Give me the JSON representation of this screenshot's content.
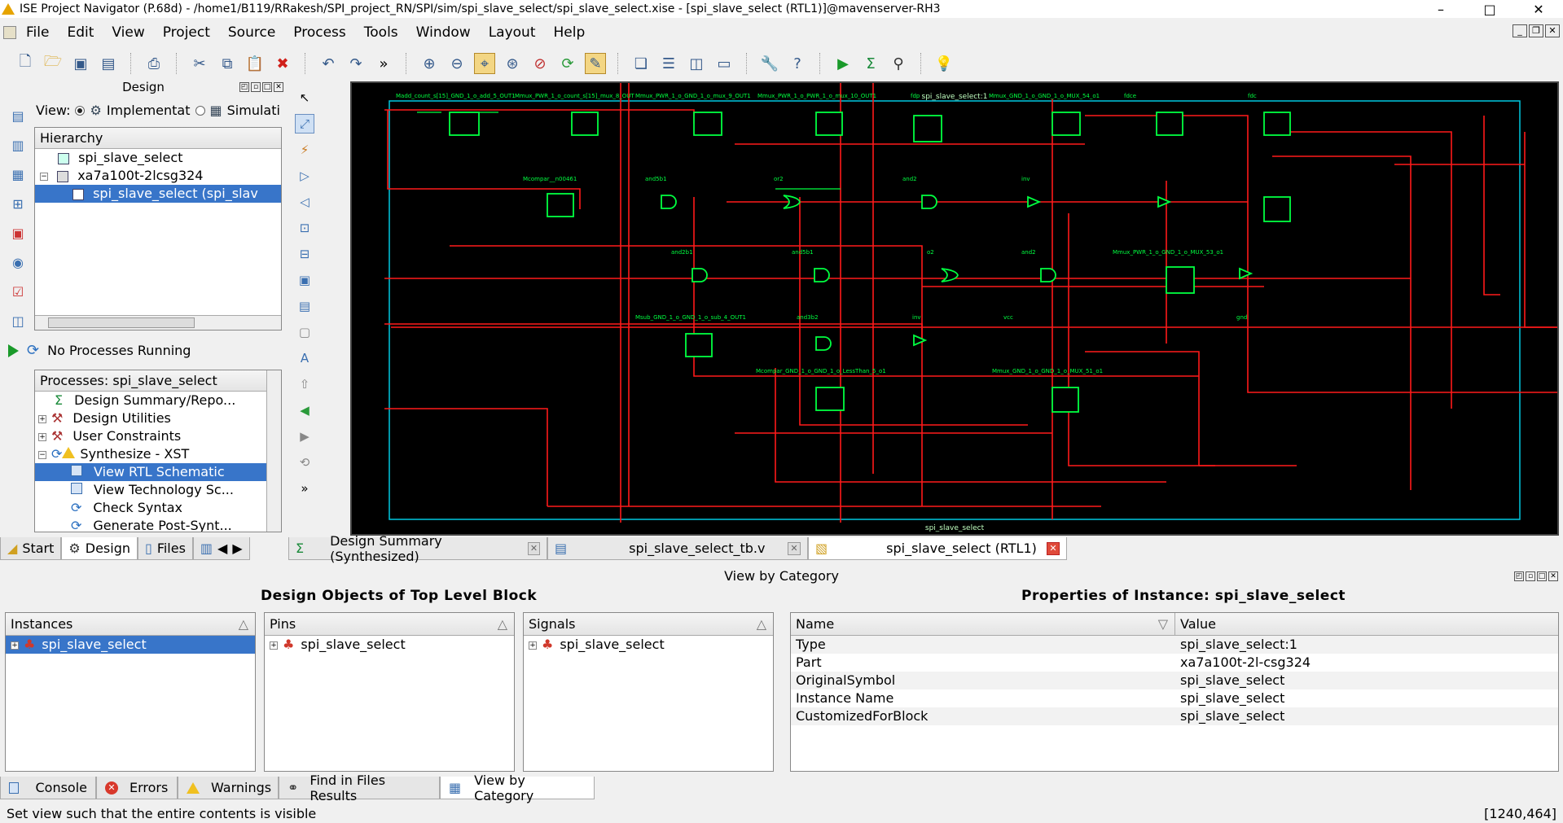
{
  "window": {
    "title": "ISE Project Navigator (P.68d) - /home1/B119/RRakesh/SPI_project_RN/SPI/sim/spi_slave_select/spi_slave_select.xise - [spi_slave_select (RTL1)]@mavenserver-RH3",
    "minimize": "–",
    "maximize": "□",
    "close": "✕"
  },
  "menu": {
    "items": [
      "File",
      "Edit",
      "View",
      "Project",
      "Source",
      "Process",
      "Tools",
      "Window",
      "Layout",
      "Help"
    ]
  },
  "design_panel": {
    "title": "Design",
    "view_label": "View:",
    "view_options": [
      "Implementat",
      "Simulati"
    ],
    "hierarchy_header": "Hierarchy",
    "hierarchy": [
      "spi_slave_select",
      "xa7a100t-2lcsg324",
      "spi_slave_select (spi_slav"
    ],
    "process_status": "No Processes Running",
    "processes_header": "Processes: spi_slave_select",
    "processes": [
      "Design Summary/Repo...",
      "Design Utilities",
      "User Constraints",
      "Synthesize - XST",
      "View RTL Schematic",
      "View Technology Sc...",
      "Check Syntax",
      "Generate Post-Synt..."
    ]
  },
  "left_tabs": [
    "Start",
    "Design",
    "Files"
  ],
  "editor_tabs": [
    "Design Summary (Synthesized)",
    "spi_slave_select_tb.v",
    "spi_slave_select (RTL1)"
  ],
  "schematic": {
    "top_label": "spi_slave_select:1",
    "bottom_label": "spi_slave_select",
    "block_labels": [
      "Madd_count_s[15]_GND_1_o_add_5_OUT1",
      "Mmux_PWR_1_o_count_s[15]_mux_8_OUT",
      "Mmux_PWR_1_o_GND_1_o_mux_9_OUT1",
      "Mmux_PWR_1_o_PWR_1_o_mux_10_OUT1",
      "fdp",
      "Mmux_GND_1_o_GND_1_o_MUX_54_o1",
      "fdce",
      "fdc",
      "Mcompar__n00461",
      "and5b1",
      "or2",
      "and2",
      "inv",
      "and2b1",
      "and5b1",
      "o2",
      "and2",
      "Mmux_PWR_1_o_GND_1_o_MUX_53_o1",
      "Msub_GND_1_o_GND_1_o_sub_4_OUT1",
      "and3b2",
      "inv",
      "vcc",
      "gnd",
      "Mcompar_GND_1_o_GND_1_o_LessThan_5_o1",
      "Mmux_GND_1_o_GND_1_o_MUX_51_o1"
    ]
  },
  "view_by_category": {
    "title": "View by Category",
    "left_title": "Design Objects of Top Level Block",
    "right_title": "Properties of Instance: spi_slave_select",
    "instances": {
      "header": "Instances",
      "items": [
        "spi_slave_select"
      ]
    },
    "pins": {
      "header": "Pins",
      "items": [
        "spi_slave_select"
      ]
    },
    "signals": {
      "header": "Signals",
      "items": [
        "spi_slave_select"
      ]
    },
    "properties": {
      "name_header": "Name",
      "value_header": "Value",
      "rows": [
        {
          "name": "Type",
          "value": "spi_slave_select:1"
        },
        {
          "name": "Part",
          "value": "xa7a100t-2l-csg324"
        },
        {
          "name": "OriginalSymbol",
          "value": "spi_slave_select"
        },
        {
          "name": "Instance Name",
          "value": "spi_slave_select"
        },
        {
          "name": "CustomizedForBlock",
          "value": "spi_slave_select"
        }
      ]
    }
  },
  "bottom_tabs": [
    "Console",
    "Errors",
    "Warnings",
    "Find in Files Results",
    "View by Category"
  ],
  "status": {
    "message": "Set view such that the entire contents is visible",
    "coords": "[1240,464]"
  }
}
